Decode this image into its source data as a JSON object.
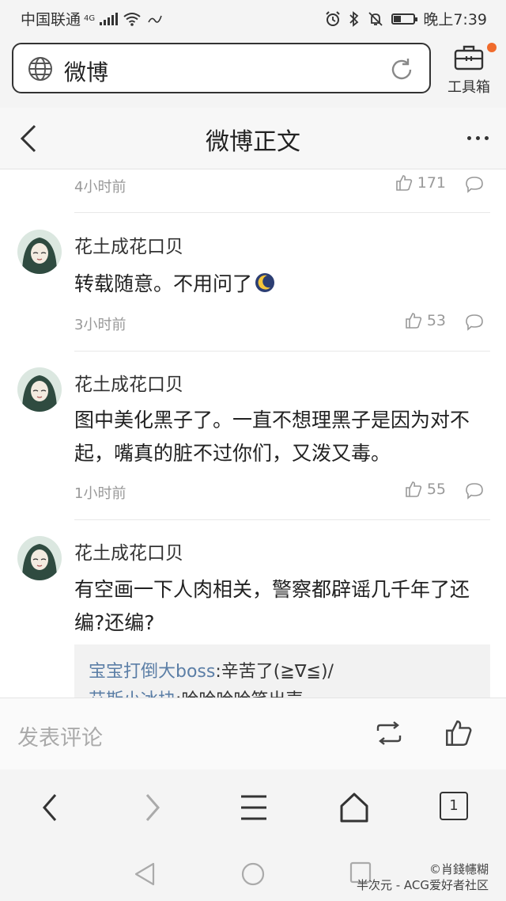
{
  "status": {
    "carrier": "中国联通",
    "network": "4G",
    "time": "晚上7:39"
  },
  "browser": {
    "url_text": "微博",
    "toolbox_label": "工具箱"
  },
  "header": {
    "title": "微博正文"
  },
  "top_meta": {
    "time": "4小时前",
    "likes": "171"
  },
  "comments": [
    {
      "name": "花土成花口贝",
      "text": "转载随意。不用问了",
      "time": "3小时前",
      "likes": "53"
    },
    {
      "name": "花土成花口贝",
      "text": "图中美化黑子了。一直不想理黑子是因为对不起，嘴真的脏不过你们，又泼又毒。",
      "time": "1小时前",
      "likes": "55"
    },
    {
      "name": "花土成花口贝",
      "text": "有空画一下人肉相关，警察都辟谣几千年了还编?还编?"
    }
  ],
  "replies": [
    {
      "user": "宝宝打倒大boss",
      "text": ":辛苦了(≧∇≦)/"
    },
    {
      "user": "艾斯小冰块",
      "text": ":哈哈哈哈笑出声"
    }
  ],
  "comment_bar": {
    "placeholder": "发表评论"
  },
  "tab_count": "1",
  "watermark": {
    "line1": "©肖錢幰糊",
    "line2": "半次元 - ACG爱好者社区"
  }
}
